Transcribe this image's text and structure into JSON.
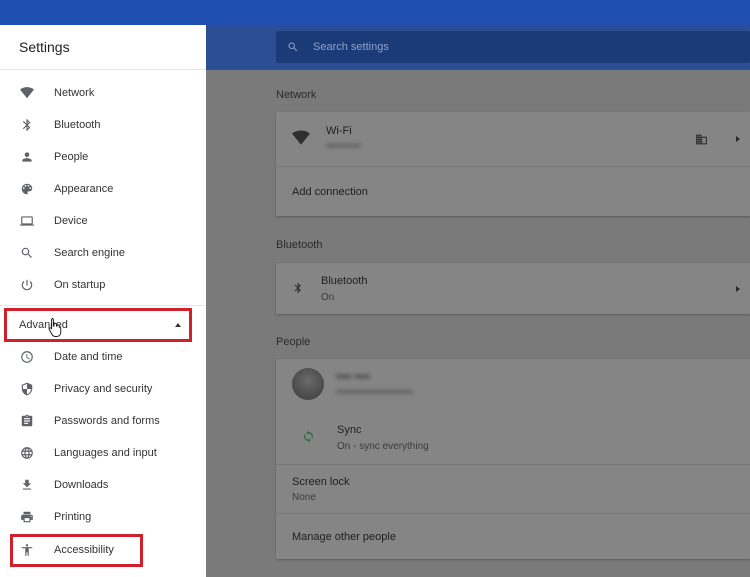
{
  "sidebar": {
    "title": "Settings",
    "items": [
      {
        "label": "Network",
        "icon": "wifi-icon"
      },
      {
        "label": "Bluetooth",
        "icon": "bluetooth-icon"
      },
      {
        "label": "People",
        "icon": "person-icon"
      },
      {
        "label": "Appearance",
        "icon": "palette-icon"
      },
      {
        "label": "Device",
        "icon": "laptop-icon"
      },
      {
        "label": "Search engine",
        "icon": "search-icon"
      },
      {
        "label": "On startup",
        "icon": "power-icon"
      }
    ],
    "advanced_label": "Advanced",
    "advanced_items": [
      {
        "label": "Date and time",
        "icon": "clock-icon"
      },
      {
        "label": "Privacy and security",
        "icon": "shield-icon"
      },
      {
        "label": "Passwords and forms",
        "icon": "clipboard-icon"
      },
      {
        "label": "Languages and input",
        "icon": "globe-icon"
      },
      {
        "label": "Downloads",
        "icon": "download-icon"
      },
      {
        "label": "Printing",
        "icon": "printer-icon"
      },
      {
        "label": "Accessibility",
        "icon": "accessibility-icon"
      }
    ]
  },
  "search": {
    "placeholder": "Search settings"
  },
  "main": {
    "network": {
      "title": "Network",
      "wifi_label": "Wi-Fi",
      "wifi_sub": "••••••••••",
      "add_connection": "Add connection"
    },
    "bluetooth": {
      "title": "Bluetooth",
      "label": "Bluetooth",
      "status": "On"
    },
    "people": {
      "title": "People",
      "user_name": "•••• ••••",
      "user_email": "••••••••••••••••••••••",
      "sync_label": "Sync",
      "sync_status": "On - sync everything",
      "screen_lock_label": "Screen lock",
      "screen_lock_value": "None",
      "manage_people": "Manage other people"
    }
  },
  "colors": {
    "topbar": "#1f4fb1",
    "highlight": "#d0202c",
    "overlay": "#7a7a7a"
  }
}
